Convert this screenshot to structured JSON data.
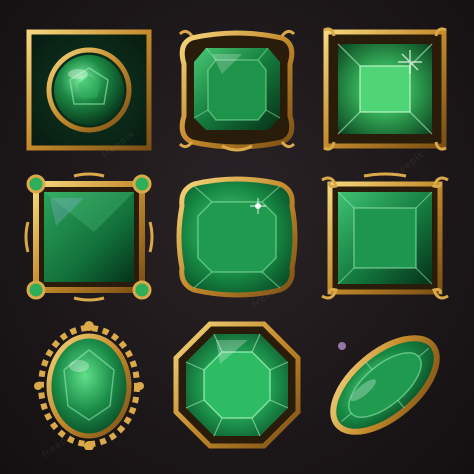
{
  "sheet": {
    "background": "#1b1618",
    "gold": "#d9a94a",
    "gold_dark": "#8a5a18",
    "emerald": "#1f8a45",
    "emerald_dark": "#0b3d22",
    "emerald_light": "#6fe08f"
  },
  "frames": [
    {
      "id": "square-round-gem",
      "shape": "square-with-oval-gem"
    },
    {
      "id": "ornate-square",
      "shape": "ornate-rounded-square"
    },
    {
      "id": "square-faceted",
      "shape": "square-step-cut"
    },
    {
      "id": "square-jeweled-corners",
      "shape": "square-with-corner-jewels"
    },
    {
      "id": "cushion",
      "shape": "cushion-cut"
    },
    {
      "id": "square-scroll",
      "shape": "square-with-scroll-corners"
    },
    {
      "id": "oval-floral",
      "shape": "oval-with-floral-border"
    },
    {
      "id": "octagon",
      "shape": "octagon-emerald-cut"
    },
    {
      "id": "tilted-oval",
      "shape": "diagonal-oval"
    }
  ],
  "watermark": "freepik"
}
